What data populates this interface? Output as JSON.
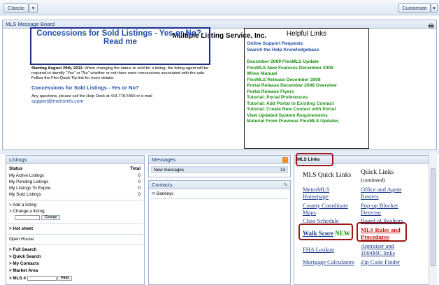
{
  "toolbar": {
    "classic_label": "Classic",
    "customize_label": "Customize"
  },
  "message_board": {
    "header": "MLS Message Board",
    "title": "Multiple Listing Service, Inc.",
    "concessions_title": "Concessions for Sold Listings - Yes or No?- Read me",
    "body_bold": "Starting August 29th, 2011:",
    "body_text": " When changing the status to sold for a listing, the listing agent will be required to identify \"Yes\" or \"No\" whether or not there were concessions associated with the sale. Follow the Flex Quick Tip link for more details:",
    "concessions_link": "Concessions for Sold Listings - Yes or No?",
    "help_text": "Any questions, please call the Help Desk at 414.778.5450 or e-mail",
    "help_email": "support@metromls.com"
  },
  "helpful_links": {
    "title": "Helpful Links",
    "blue_links": [
      "Online Support Requests",
      "Search the Help Knowledgebase"
    ],
    "green_links": [
      "December 2009 FlexMLS Update",
      "FlexMLS New Features December 2009",
      "Wirex Manual",
      "FlexMLS Release December 2008",
      "Portal Release December 2008 Overview",
      "Portal Release Flyers",
      "Tutorial: Portal Preferences",
      "Tutorial: Add Portal to Existing Contact",
      "Tutorial: Create New Contact with Portal",
      "View Updated System Requirements",
      "Material From Previous FlexMLS Updates"
    ]
  },
  "listings": {
    "header": "Listings",
    "status_label": "Status",
    "total_label": "Total",
    "rows": [
      {
        "label": "My Active Listings",
        "total": "0"
      },
      {
        "label": "My Pending Listings",
        "total": "0"
      },
      {
        "label": "My Listings To Expire",
        "total": "0"
      },
      {
        "label": "My Sold Listings",
        "total": "0"
      }
    ],
    "add_listing": "> Add a listing",
    "change_listing": "> Change a listing",
    "change_button": "Change",
    "hot_sheet": "> Hot sheet",
    "open_house": "Open House",
    "full_search": "> Full Search",
    "quick_search": "> Quick Search",
    "my_contacts": "> My Contacts",
    "market_area": "> Market Area",
    "mls_number": "> MLS #",
    "find_button": "Find"
  },
  "messages": {
    "header": "Messages",
    "new_label": "New messages",
    "new_count": "13"
  },
  "contacts": {
    "header": "Contacts",
    "items": [
      "Barkleys"
    ]
  },
  "mls_links": {
    "header": "MLS Links",
    "quick_links_title": "MLS Quick Links",
    "quick_links_title2": "Quick Links",
    "continued": "(continued)",
    "left_links": [
      "MetroMLS Homepage",
      "County Coordinate Maps",
      "Class Schedule",
      "Walk Score",
      "FHA Lookup",
      "Mortgage Calculators"
    ],
    "walk_new": "NEW",
    "right_links": [
      "Office and Agent Rosters",
      "Pop-up Blocker Detector",
      "Board of Realtors",
      "MLS Rules and Procedures",
      "Appraiser and 1004MC links",
      "Zip Code Finder"
    ]
  },
  "colors": {
    "link_blue": "#1f4fa5",
    "link_green": "#17910f",
    "highlight_red": "#9b1717",
    "panel_header": "#1e3f78"
  }
}
